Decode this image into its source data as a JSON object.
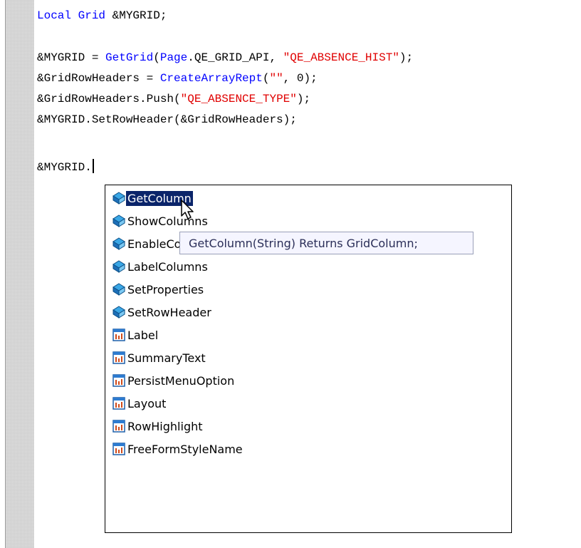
{
  "editor": {
    "lines": [
      {
        "parts": [
          {
            "text": "Local Grid",
            "type": "kw"
          },
          {
            "text": " &MYGRID;",
            "type": "plain"
          }
        ]
      },
      {
        "parts": [
          {
            "text": "&MYGRID = ",
            "type": "plain"
          },
          {
            "text": "GetGrid",
            "type": "kw"
          },
          {
            "text": "(",
            "type": "plain"
          },
          {
            "text": "Page",
            "type": "kw"
          },
          {
            "text": ".QE_GRID_API, ",
            "type": "plain"
          },
          {
            "text": "\"QE_ABSENCE_HIST\"",
            "type": "str"
          },
          {
            "text": ");",
            "type": "plain"
          }
        ]
      },
      {
        "parts": [
          {
            "text": "&GridRowHeaders = ",
            "type": "plain"
          },
          {
            "text": "CreateArrayRept",
            "type": "kw"
          },
          {
            "text": "(",
            "type": "plain"
          },
          {
            "text": "\"\"",
            "type": "str"
          },
          {
            "text": ", 0);",
            "type": "plain"
          }
        ]
      },
      {
        "parts": [
          {
            "text": "&GridRowHeaders.Push(",
            "type": "plain"
          },
          {
            "text": "\"QE_ABSENCE_TYPE\"",
            "type": "str"
          },
          {
            "text": ");",
            "type": "plain"
          }
        ]
      },
      {
        "parts": [
          {
            "text": "&MYGRID.SetRowHeader(&GridRowHeaders);",
            "type": "plain"
          }
        ]
      },
      {
        "parts": [
          {
            "text": "&MYGRID.",
            "type": "plain"
          }
        ]
      }
    ]
  },
  "completion": {
    "items": [
      {
        "label": "GetColumn",
        "icon": "method-icon",
        "selected": true
      },
      {
        "label": "ShowColumns",
        "icon": "method-icon"
      },
      {
        "label": "EnableColumns",
        "icon": "method-icon"
      },
      {
        "label": "LabelColumns",
        "icon": "method-icon"
      },
      {
        "label": "SetProperties",
        "icon": "method-icon"
      },
      {
        "label": "SetRowHeader",
        "icon": "method-icon"
      },
      {
        "label": "Label",
        "icon": "property-icon"
      },
      {
        "label": "SummaryText",
        "icon": "property-icon"
      },
      {
        "label": "PersistMenuOption",
        "icon": "property-icon"
      },
      {
        "label": "Layout",
        "icon": "property-icon"
      },
      {
        "label": "RowHighlight",
        "icon": "property-icon"
      },
      {
        "label": "FreeFormStyleName",
        "icon": "property-icon"
      }
    ]
  },
  "tooltip": {
    "text": "GetColumn(String) Returns GridColumn;"
  },
  "colors": {
    "keyword": "#0000ff",
    "string": "#e00000",
    "selection": "#0a246a",
    "tooltip_bg": "#f5f5ff"
  }
}
